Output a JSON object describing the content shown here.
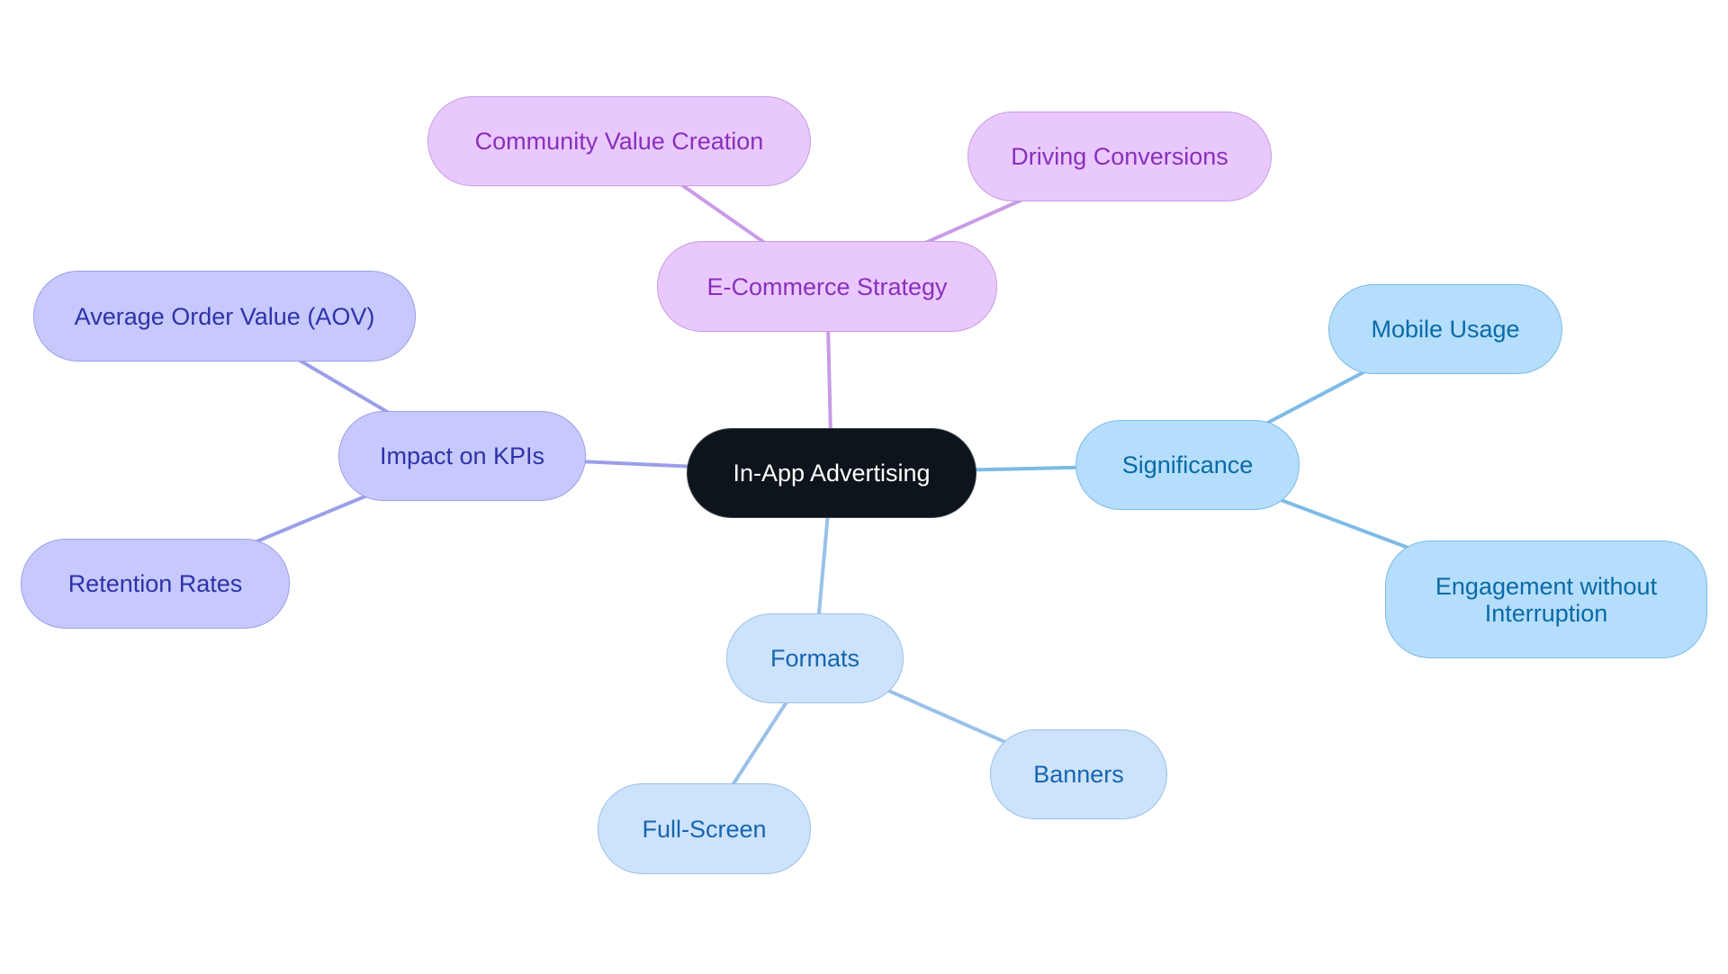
{
  "diagram": {
    "type": "mindmap",
    "root": {
      "id": "root",
      "label": "In-App Advertising",
      "style": "root"
    },
    "colors": {
      "root_fill": "#0d141b",
      "ecommerce_fill": "#e9c9fd",
      "ecommerce_text": "#8a2fbd",
      "ecommerce_edge": "#c99be6",
      "kpi_fill": "#c7c9fd",
      "kpi_text": "#2e32a8",
      "kpi_edge": "#9b9fe8",
      "significance_fill": "#b4defc",
      "significance_text": "#0a6aa6",
      "significance_edge": "#7ebbe6",
      "formats_fill": "#cde3fb",
      "formats_text": "#1665b0",
      "formats_edge": "#99c1e9"
    },
    "branches": [
      {
        "id": "ecommerce",
        "label": "E-Commerce Strategy",
        "style": "purple",
        "children": [
          {
            "id": "community",
            "label": "Community Value Creation"
          },
          {
            "id": "driving",
            "label": "Driving Conversions"
          }
        ]
      },
      {
        "id": "kpis",
        "label": "Impact on KPIs",
        "style": "indigo",
        "children": [
          {
            "id": "aov",
            "label": "Average Order Value (AOV)"
          },
          {
            "id": "retention",
            "label": "Retention Rates"
          }
        ]
      },
      {
        "id": "significance",
        "label": "Significance",
        "style": "sky",
        "children": [
          {
            "id": "mobile",
            "label": "Mobile Usage"
          },
          {
            "id": "engagement",
            "label": "Engagement without Interruption"
          }
        ]
      },
      {
        "id": "formats",
        "label": "Formats",
        "style": "pale",
        "children": [
          {
            "id": "fullscreen",
            "label": "Full-Screen"
          },
          {
            "id": "banners",
            "label": "Banners"
          }
        ]
      }
    ]
  }
}
